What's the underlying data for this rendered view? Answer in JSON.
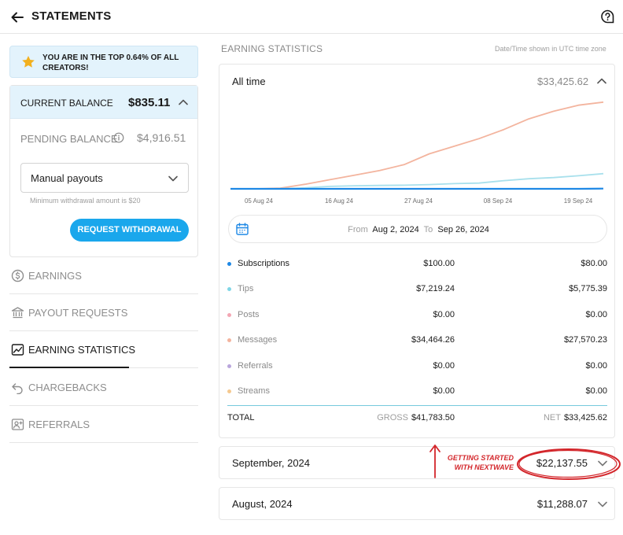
{
  "header": {
    "title": "STATEMENTS",
    "back_icon": "arrow-left-icon",
    "help_icon": "question-bubble-icon"
  },
  "sidebar": {
    "banner_text": "YOU ARE IN THE TOP 0.64% OF ALL CREATORS!",
    "balance": {
      "current_label": "CURRENT BALANCE",
      "current_value": "$835.11",
      "pending_label": "PENDING BALANCE",
      "pending_value": "$4,916.51",
      "payout_select_value": "Manual payouts",
      "min_withdrawal_note": "Minimum withdrawal amount is $20",
      "withdraw_button": "REQUEST WITHDRAWAL"
    },
    "nav": [
      {
        "label": "EARNINGS",
        "icon": "dollar-circle-icon",
        "active": false
      },
      {
        "label": "PAYOUT REQUESTS",
        "icon": "bank-icon",
        "active": false
      },
      {
        "label": "EARNING STATISTICS",
        "icon": "trend-chart-icon",
        "active": true
      },
      {
        "label": "CHARGEBACKS",
        "icon": "undo-arrow-icon",
        "active": false
      },
      {
        "label": "REFERRALS",
        "icon": "user-plus-icon",
        "active": false
      }
    ]
  },
  "main": {
    "section_title": "EARNING STATISTICS",
    "timezone_note": "Date/Time shown in UTC time zone",
    "period_label": "All time",
    "period_total": "$33,425.62",
    "date_range": {
      "from_label": "From",
      "from_value": "Aug 2, 2024",
      "to_label": "To",
      "to_value": "Sep 26, 2024"
    },
    "rows": [
      {
        "name": "Subscriptions",
        "gross": "$100.00",
        "net": "$80.00",
        "color": "#1e88e5"
      },
      {
        "name": "Tips",
        "gross": "$7,219.24",
        "net": "$5,775.39",
        "color": "#7fd6e6"
      },
      {
        "name": "Posts",
        "gross": "$0.00",
        "net": "$0.00",
        "color": "#f3a6b3"
      },
      {
        "name": "Messages",
        "gross": "$34,464.26",
        "net": "$27,570.23",
        "color": "#f3b49e"
      },
      {
        "name": "Referrals",
        "gross": "$0.00",
        "net": "$0.00",
        "color": "#b9a6dc"
      },
      {
        "name": "Streams",
        "gross": "$0.00",
        "net": "$0.00",
        "color": "#f5c98f"
      }
    ],
    "total": {
      "label": "TOTAL",
      "gross_tag": "GROSS",
      "gross": "$41,783.50",
      "net_tag": "NET",
      "net": "$33,425.62"
    },
    "months": [
      {
        "label": "September, 2024",
        "value": "$22,137.55"
      },
      {
        "label": "August, 2024",
        "value": "$11,288.07"
      }
    ]
  },
  "chart_data": {
    "type": "line",
    "x": [
      "Aug 2",
      "Aug 5",
      "Aug 9",
      "Aug 13",
      "Aug 16",
      "Aug 20",
      "Aug 24",
      "Aug 27",
      "Aug 31",
      "Sep 4",
      "Sep 8",
      "Sep 12",
      "Sep 16",
      "Sep 19",
      "Sep 23",
      "Sep 26"
    ],
    "x_ticks": [
      "05 Aug 24",
      "16 Aug 24",
      "27 Aug 24",
      "08 Sep 24",
      "19 Sep 24"
    ],
    "series": [
      {
        "color": "#f3b49e",
        "values": [
          0,
          0,
          200,
          1500,
          3000,
          4500,
          6000,
          8000,
          11500,
          14000,
          16500,
          19500,
          23000,
          25500,
          27500,
          28500
        ]
      },
      {
        "color": "#a8e0ec",
        "values": [
          0,
          0,
          50,
          300,
          800,
          1000,
          1100,
          1200,
          1400,
          1700,
          1900,
          2700,
          3300,
          3700,
          4300,
          5000
        ]
      },
      {
        "color": "#1e88e5",
        "values": [
          0,
          0,
          0,
          0,
          0,
          0,
          0,
          0,
          0,
          0,
          0,
          0,
          0,
          0,
          0,
          80
        ]
      }
    ],
    "ylim": [
      0,
      30000
    ],
    "grid": false
  },
  "annotation": {
    "text_line1": "GETTING STARTED",
    "text_line2": "WITH NEXTWAVE",
    "color": "#d3262b"
  }
}
